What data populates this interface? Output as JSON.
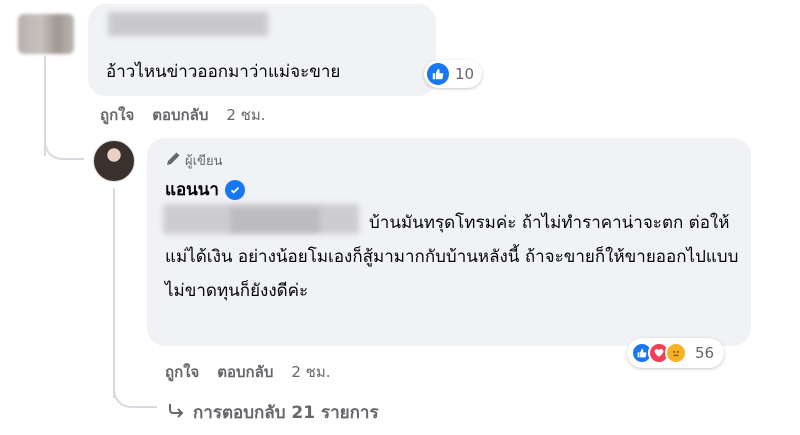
{
  "comment1": {
    "text": "อ้าวไหนข่าวออกมาว่าแม่จะขาย",
    "like_count": "10",
    "actions": {
      "like": "ถูกใจ",
      "reply": "ตอบกลับ",
      "time": "2 ชม."
    }
  },
  "comment2": {
    "author_label": "ผู้เขียน",
    "author_name": "แอนนา",
    "text": "บ้านมันทรุดโทรมค่ะ ถ้าไม่ทำราคาน่าจะตก ต่อให้แม่ได้เงิน อย่างน้อยโมเองก็สู้มามากกับบ้านหลังนี้ ถ้าจะขายก็ให้ขายออกไปแบบไม่ขาดทุนก็ยังงดีค่ะ",
    "reaction_count": "56",
    "actions": {
      "like": "ถูกใจ",
      "reply": "ตอบกลับ",
      "time": "2 ชม."
    }
  },
  "more_replies": {
    "label": "การตอบกลับ 21 รายการ"
  },
  "colors": {
    "accent": "#1877f2",
    "bubble": "#f0f2f5",
    "muted": "#65676b"
  }
}
